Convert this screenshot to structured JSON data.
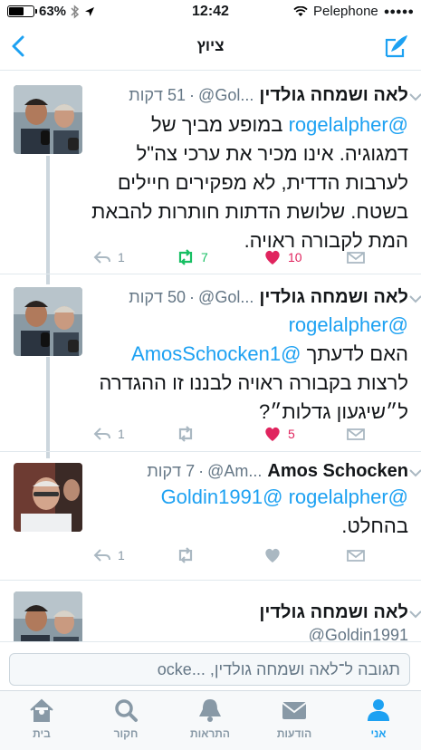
{
  "status_bar": {
    "battery_percent": "63%",
    "battery_level": 0.63,
    "time": "12:42",
    "carrier": "Pelephone",
    "signal_dots": "●●●●●"
  },
  "nav": {
    "title": "ציוץ",
    "back_icon": "chevron-left-icon",
    "compose_icon": "compose-quill-icon"
  },
  "tweets": [
    {
      "author": "לאה ושמחה גולדין",
      "handle": "@Gol...",
      "time": "51 דקות",
      "text_parts": [
        {
          "text": "@rogelalpher",
          "mention": true
        },
        {
          "text": " במופע מביך של דמגוגיה. אינו מכיר את ערכי צה\"ל לערבות הדדית, לא מפקירים חיילים בשטח. שלושת הדתות חותרות להבאת המת לקבורה ראויה.",
          "mention": false
        }
      ],
      "replies": "1",
      "retweets": "7",
      "likes": "10"
    },
    {
      "author": "לאה ושמחה גולדין",
      "handle": "@Gol...",
      "time": "50 דקות",
      "line1": "@rogelalpher",
      "line2_mention": "@AmosSchocken1",
      "line2_text": "האם לדעתך",
      "line3": "לרצות בקבורה ראויה לבננו זו ההגדרה",
      "line4": "ל״שיגעון גדלות״?",
      "replies": "1",
      "retweets": "",
      "likes": "5"
    },
    {
      "author": "Amos Schocken",
      "handle": "@Am...",
      "time": "7 דקות",
      "line1_mention_a": "@rogelalpher",
      "line1_mention_b": "@Goldin1991",
      "line2": "בהחלט.",
      "replies": "1",
      "retweets": "",
      "likes": ""
    },
    {
      "author": "לאה ושמחה גולדין",
      "handle": "@Goldin1991"
    }
  ],
  "reply_bar": {
    "placeholder": "תגובה ל־לאה ושמחה גולדין, ...ocke"
  },
  "tabs": [
    {
      "label": "בית",
      "icon": "home-icon"
    },
    {
      "label": "חקור",
      "icon": "search-icon"
    },
    {
      "label": "התראות",
      "icon": "bell-icon"
    },
    {
      "label": "הודעות",
      "icon": "envelope-icon"
    },
    {
      "label": "אני",
      "icon": "person-icon",
      "active": true
    }
  ],
  "colors": {
    "accent": "#1da1f2",
    "retweet_active": "#17bf63",
    "like_active": "#e0245e",
    "muted": "#8899a6"
  }
}
